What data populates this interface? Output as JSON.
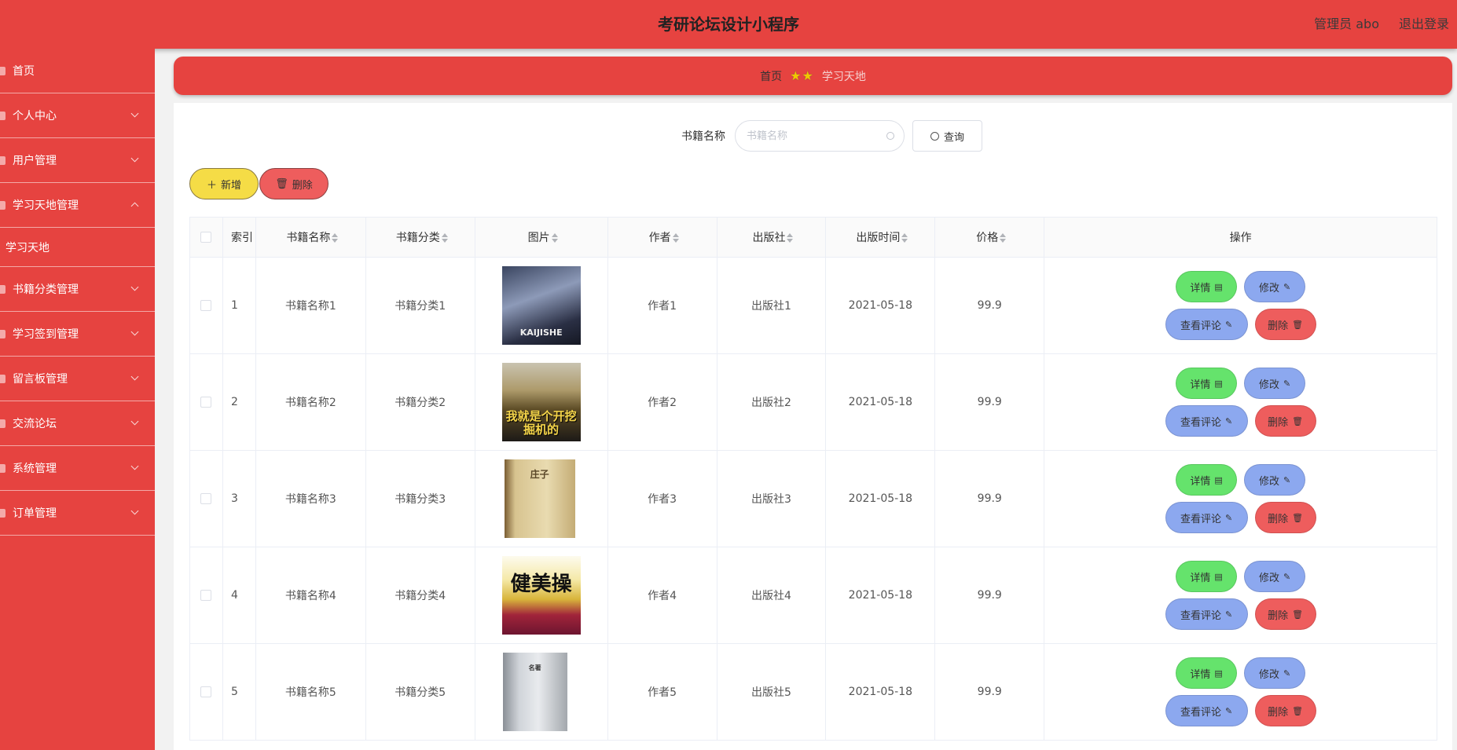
{
  "header": {
    "title": "考研论坛设计小程序",
    "user": "管理员 abo",
    "logout": "退出登录"
  },
  "sidebar": {
    "items": [
      {
        "label": "首页"
      },
      {
        "label": "个人中心"
      },
      {
        "label": "用户管理"
      },
      {
        "label": "学习天地管理"
      },
      {
        "label": "学习天地"
      },
      {
        "label": "书籍分类管理"
      },
      {
        "label": "学习签到管理"
      },
      {
        "label": "留言板管理"
      },
      {
        "label": "交流论坛"
      },
      {
        "label": "系统管理"
      },
      {
        "label": "订单管理"
      }
    ]
  },
  "breadcrumb": {
    "home": "首页",
    "stars": "★★",
    "current": "学习天地"
  },
  "search": {
    "label": "书籍名称",
    "placeholder": "书籍名称",
    "query_button": "查询"
  },
  "actions": {
    "add": "新增",
    "delete": "删除"
  },
  "table": {
    "columns": [
      "索引",
      "书籍名称",
      "书籍分类",
      "图片",
      "作者",
      "出版社",
      "出版时间",
      "价格",
      "操作"
    ],
    "rows": [
      {
        "index": "1",
        "name": "书籍名称1",
        "category": "书籍分类1",
        "cover_text": "KAIJISHE",
        "author": "作者1",
        "publisher": "出版社1",
        "date": "2021-05-18",
        "price": "99.9"
      },
      {
        "index": "2",
        "name": "书籍名称2",
        "category": "书籍分类2",
        "cover_text": "我就是个开挖掘机的",
        "author": "作者2",
        "publisher": "出版社2",
        "date": "2021-05-18",
        "price": "99.9"
      },
      {
        "index": "3",
        "name": "书籍名称3",
        "category": "书籍分类3",
        "cover_text": "庄子",
        "author": "作者3",
        "publisher": "出版社3",
        "date": "2021-05-18",
        "price": "99.9"
      },
      {
        "index": "4",
        "name": "书籍名称4",
        "category": "书籍分类4",
        "cover_text": "健美操",
        "author": "作者4",
        "publisher": "出版社4",
        "date": "2021-05-18",
        "price": "99.9"
      },
      {
        "index": "5",
        "name": "书籍名称5",
        "category": "书籍分类5",
        "cover_text": "名著",
        "author": "作者5",
        "publisher": "出版社5",
        "date": "2021-05-18",
        "price": "99.9"
      }
    ],
    "op_labels": {
      "detail": "详情",
      "edit": "修改",
      "comments": "查看评论",
      "delete": "删除"
    }
  },
  "colors": {
    "primary": "#e64340",
    "detail": "#65e36c",
    "edit": "#8ca8ef",
    "delete": "#ee5d5d",
    "add": "#f5dc46"
  }
}
